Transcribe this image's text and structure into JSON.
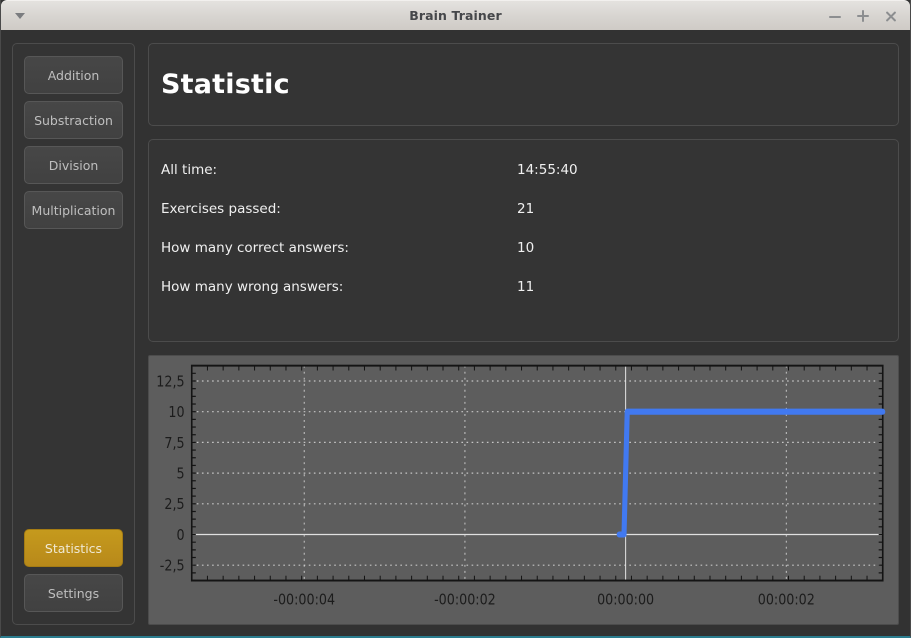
{
  "window": {
    "title": "Brain Trainer",
    "menu_icon": "caret-down-icon",
    "minimize_label": "−",
    "maximize_label": "+",
    "close_label": "×"
  },
  "sidebar": {
    "operations": [
      {
        "label": "Addition",
        "active": false
      },
      {
        "label": "Substraction",
        "active": false
      },
      {
        "label": "Division",
        "active": false
      },
      {
        "label": "Multiplication",
        "active": false
      }
    ],
    "bottom": [
      {
        "label": "Statistics",
        "active": true
      },
      {
        "label": "Settings",
        "active": false
      }
    ]
  },
  "header": {
    "title": "Statistic"
  },
  "stats": {
    "rows": [
      {
        "label": "All time:",
        "value": "14:55:40"
      },
      {
        "label": "Exercises passed:",
        "value": "21"
      },
      {
        "label": "How many correct answers:",
        "value": "10"
      },
      {
        "label": "How many wrong answers:",
        "value": "11"
      }
    ]
  },
  "chart_data": {
    "type": "line",
    "title": "",
    "xlabel": "",
    "ylabel": "",
    "ylim": [
      -3.75,
      13.75
    ],
    "xlim": [
      -5.4,
      3.2
    ],
    "yticks": [
      12.5,
      10,
      7.5,
      5,
      2.5,
      0,
      -2.5
    ],
    "ytick_labels": [
      "12,5",
      "10",
      "7,5",
      "5",
      "2,5",
      "0",
      "-2,5"
    ],
    "xticks": [
      -4,
      -2,
      0,
      2
    ],
    "xtick_labels": [
      "-00:00:04",
      "-00:00:02",
      "00:00:00",
      "00:00:02"
    ],
    "grid": true,
    "legend": "none",
    "series": [
      {
        "name": "correct answers",
        "color": "#4179f0",
        "x": [
          -0.08,
          -0.02,
          0.02,
          3.2
        ],
        "y": [
          0,
          0,
          10,
          10
        ]
      }
    ],
    "plot_bg": "#5d5d5d",
    "grid_color": "#d8d8d8",
    "axis_color": "#e8e8e8",
    "tick_label_color": "#1c1c1c"
  }
}
